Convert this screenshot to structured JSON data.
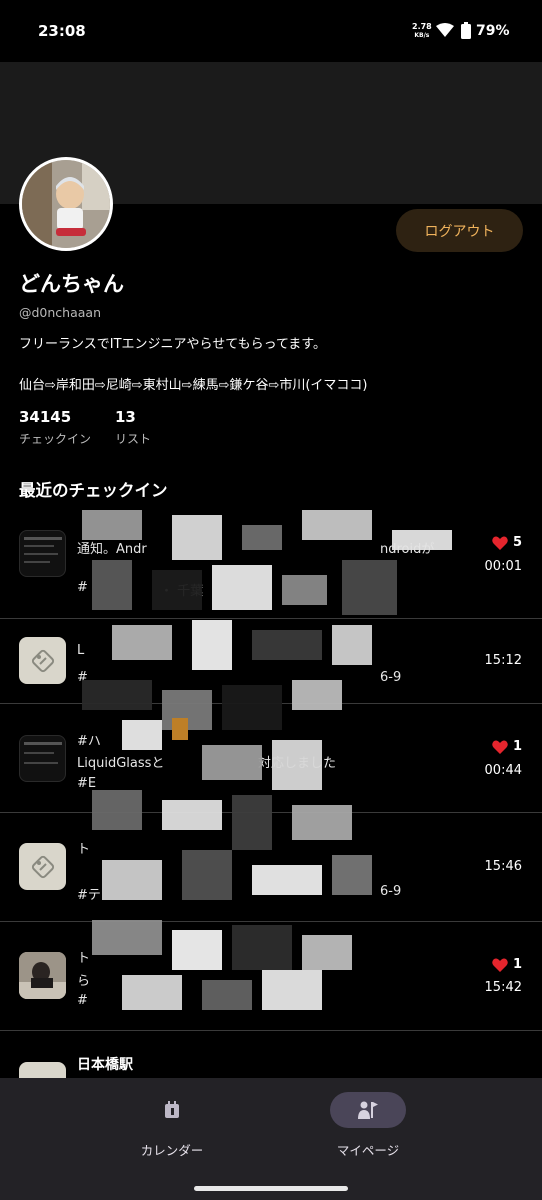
{
  "status_bar": {
    "time": "23:08",
    "net_speed_value": "2.78",
    "net_speed_unit": "KB/s",
    "battery": "79%"
  },
  "profile": {
    "logout_label": "ログアウト",
    "display_name": "どんちゃん",
    "handle": "@d0nchaaan",
    "bio_line1": "フリーランスでITエンジニアやらせてもらってます。",
    "bio_line2": "仙台⇨岸和田⇨尼崎⇨東村山⇨練馬⇨鎌ケ谷⇨市川(イマココ)",
    "stats": [
      {
        "value": "34145",
        "label": "チェックイン"
      },
      {
        "value": "13",
        "label": "リスト"
      }
    ]
  },
  "recent_checkins": {
    "title": "最近のチェックイン",
    "items": [
      {
        "line1": "通知。Andr",
        "line1b": "ndroidが",
        "line2": "#",
        "line2b": "・ 千葉",
        "likes": "5",
        "time": "00:01"
      },
      {
        "line1": "L",
        "line2": "#",
        "line2b": "6-9",
        "time": "15:12"
      },
      {
        "line1": "#ハ",
        "line2": "LiquidGlassと",
        "line2b": "対応しました",
        "line3": "#E",
        "likes": "1",
        "time": "00:44"
      },
      {
        "line1": "ト",
        "line2": "#テ",
        "line2b": "6-9",
        "time": "15:46"
      },
      {
        "line1": "ト",
        "line2": "ら",
        "line3": "#",
        "likes": "1",
        "time": "15:42"
      },
      {
        "line1": "日本橋駅"
      }
    ]
  },
  "bottom_nav": {
    "items": [
      {
        "label": "カレンダー"
      },
      {
        "label": "マイページ"
      }
    ]
  },
  "colors": {
    "accent_orange": "#f0b35c",
    "heart_red": "#e5252d",
    "nav_active": "#4a4558"
  }
}
